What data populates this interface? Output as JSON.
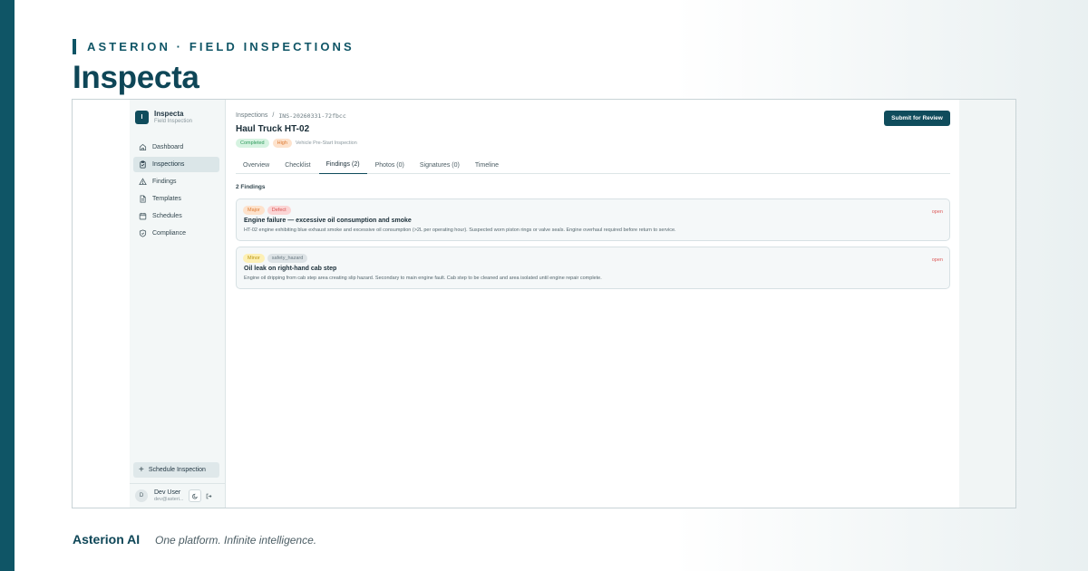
{
  "header": {
    "eyebrow": "ASTERION · FIELD INSPECTIONS",
    "title": "Inspecta"
  },
  "app": {
    "brand": {
      "logo_letter": "I",
      "name": "Inspecta",
      "subtitle": "Field Inspection"
    },
    "nav": [
      {
        "label": "Dashboard",
        "icon": "home-icon",
        "active": false
      },
      {
        "label": "Inspections",
        "icon": "clipboard-icon",
        "active": true
      },
      {
        "label": "Findings",
        "icon": "warning-triangle-icon",
        "active": false
      },
      {
        "label": "Templates",
        "icon": "document-icon",
        "active": false
      },
      {
        "label": "Schedules",
        "icon": "calendar-icon",
        "active": false
      },
      {
        "label": "Compliance",
        "icon": "shield-icon",
        "active": false
      }
    ],
    "schedule_button": "Schedule Inspection",
    "user": {
      "initial": "D",
      "name": "Dev User",
      "email": "dev@asteri..."
    }
  },
  "main": {
    "breadcrumb": {
      "root": "Inspections",
      "sep": "/",
      "id": "INS-20260331-72fbcc"
    },
    "title": "Haul Truck HT-02",
    "badges": {
      "status": "Completed",
      "priority": "High",
      "type": "Vehicle Pre-Start Inspection"
    },
    "submit_button": "Submit for Review",
    "tabs": [
      {
        "label": "Overview",
        "active": false
      },
      {
        "label": "Checklist",
        "active": false
      },
      {
        "label": "Findings (2)",
        "active": true
      },
      {
        "label": "Photos (0)",
        "active": false
      },
      {
        "label": "Signatures (0)",
        "active": false
      },
      {
        "label": "Timeline",
        "active": false
      }
    ],
    "findings_count": "2 Findings",
    "findings": [
      {
        "tags": [
          "Major",
          "Defect"
        ],
        "title": "Engine failure — excessive oil consumption and smoke",
        "description": "HT-02 engine exhibiting blue exhaust smoke and excessive oil consumption (>2L per operating hour). Suspected worn piston rings or valve seals. Engine overhaul required before return to service.",
        "status": "open"
      },
      {
        "tags": [
          "Minor",
          "safety_hazard"
        ],
        "title": "Oil leak on right-hand cab step",
        "description": "Engine oil dripping from cab step area creating slip hazard. Secondary to main engine fault. Cab step to be cleaned and area isolated until engine repair complete.",
        "status": "open"
      }
    ]
  },
  "footer": {
    "brand": "Asterion AI",
    "tagline": "One platform. Infinite intelligence."
  },
  "colors": {
    "brand_teal": "#0f4c5c",
    "band": "#0f5566",
    "open_status": "#dd5b5b"
  }
}
